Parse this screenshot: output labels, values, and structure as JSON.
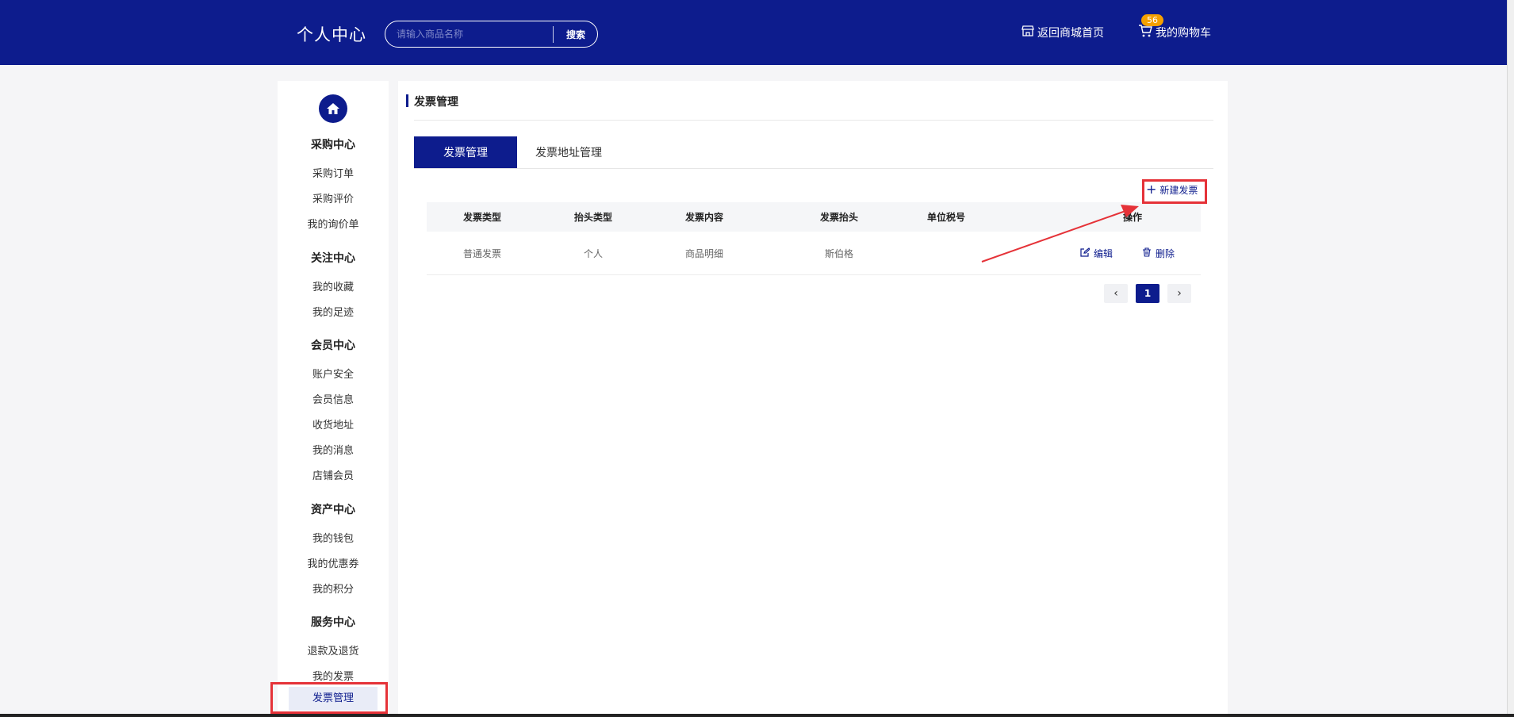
{
  "header": {
    "title": "个人中心",
    "search": {
      "placeholder": "请输入商品名称",
      "button_label": "搜索"
    },
    "home_link": "返回商城首页",
    "cart_link": "我的购物车",
    "cart_count": "56"
  },
  "sidebar": {
    "sections": [
      {
        "title": "采购中心",
        "items": [
          "采购订单",
          "采购评价",
          "我的询价单"
        ]
      },
      {
        "title": "关注中心",
        "items": [
          "我的收藏",
          "我的足迹"
        ]
      },
      {
        "title": "会员中心",
        "items": [
          "账户安全",
          "会员信息",
          "收货地址",
          "我的消息",
          "店铺会员"
        ]
      },
      {
        "title": "资产中心",
        "items": [
          "我的钱包",
          "我的优惠券",
          "我的积分"
        ]
      },
      {
        "title": "服务中心",
        "items": [
          "退款及退货",
          "我的发票",
          "发票管理"
        ]
      }
    ],
    "active_item": "发票管理"
  },
  "main": {
    "page_title": "发票管理",
    "tabs": [
      {
        "label": "发票管理",
        "active": true
      },
      {
        "label": "发票地址管理",
        "active": false
      }
    ],
    "new_button": "新建发票",
    "table": {
      "columns": [
        "发票类型",
        "抬头类型",
        "发票内容",
        "发票抬头",
        "单位税号",
        "操作"
      ],
      "rows": [
        {
          "type": "普通发票",
          "title_type": "个人",
          "content": "商品明细",
          "title": "斯伯格",
          "tax_no": "",
          "edit": "编辑",
          "delete": "删除"
        }
      ]
    },
    "pagination": {
      "current_page": "1",
      "prev": "‹",
      "next": "›"
    }
  },
  "colors": {
    "brand": "#0d1c8d",
    "badge": "#f5a000",
    "annotation": "#e53238"
  }
}
